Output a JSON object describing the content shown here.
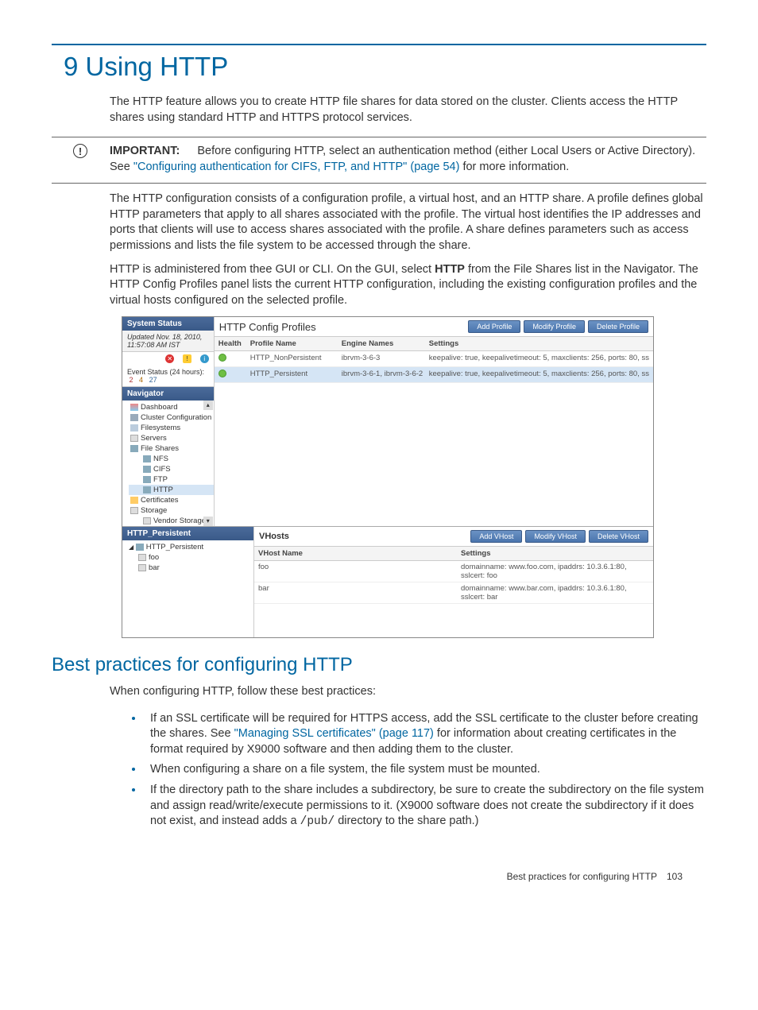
{
  "chapter": {
    "number": "9",
    "title": "Using HTTP"
  },
  "intro": "The HTTP feature allows you to create HTTP file shares for data stored on the cluster. Clients access the HTTP shares using standard HTTP and HTTPS protocol services.",
  "important": {
    "label": "IMPORTANT:",
    "before_link": "Before configuring HTTP, select an authentication method (either Local Users or Active Directory). See ",
    "link": "\"Configuring authentication for CIFS, FTP, and HTTP\" (page 54)",
    "after_link": " for more information."
  },
  "config_para": "The HTTP configuration consists of a configuration profile, a virtual host, and an HTTP share. A profile defines global HTTP parameters that apply to all shares associated with the profile. The virtual host identifies the IP addresses and ports that clients will use to access shares associated with the profile. A share defines parameters such as access permissions and lists the file system to be accessed through the share.",
  "admin_para": {
    "before_bold": "HTTP is administered from thee GUI or CLI. On the GUI, select ",
    "bold": "HTTP",
    "after_bold": " from the File Shares list in the Navigator. The HTTP Config Profiles panel lists the current HTTP configuration, including the existing configuration profiles and the virtual hosts configured on the selected profile."
  },
  "screenshot": {
    "system_status": {
      "title": "System Status",
      "updated": "Updated Nov. 18, 2010, 11:57:08 AM IST",
      "event_label": "Event Status (24 hours):",
      "red": "2",
      "yellow": "4",
      "blue": "27"
    },
    "navigator": {
      "title": "Navigator",
      "items": [
        {
          "label": "Dashboard"
        },
        {
          "label": "Cluster Configuration"
        },
        {
          "label": "Filesystems"
        },
        {
          "label": "Servers"
        },
        {
          "label": "File Shares"
        },
        {
          "label": "NFS",
          "indent": true
        },
        {
          "label": "CIFS",
          "indent": true
        },
        {
          "label": "FTP",
          "indent": true
        },
        {
          "label": "HTTP",
          "indent": true,
          "selected": true
        },
        {
          "label": "Certificates"
        },
        {
          "label": "Storage"
        },
        {
          "label": "Vendor Storage",
          "indent": true
        }
      ]
    },
    "profiles": {
      "title": "HTTP Config Profiles",
      "btn_add": "Add Profile",
      "btn_mod": "Modify Profile",
      "btn_del": "Delete Profile",
      "cols": {
        "health": "Health",
        "profile": "Profile Name",
        "engine": "Engine Names",
        "settings": "Settings"
      },
      "rows": [
        {
          "profile": "HTTP_NonPersistent",
          "engine": "ibrvm-3-6-3",
          "settings": "keepalive: true, keepalivetimeout: 5, maxclients: 256, ports: 80, ss",
          "selected": false
        },
        {
          "profile": "HTTP_Persistent",
          "engine": "ibrvm-3-6-1, ibrvm-3-6-2",
          "settings": "keepalive: true, keepalivetimeout: 5, maxclients: 256, ports: 80, ss",
          "selected": true
        }
      ]
    },
    "tree": {
      "title": "HTTP_Persistent",
      "root": "HTTP_Persistent",
      "items": [
        "foo",
        "bar"
      ]
    },
    "vhosts": {
      "title": "VHosts",
      "btn_add": "Add VHost",
      "btn_mod": "Modify VHost",
      "btn_del": "Delete VHost",
      "cols": {
        "name": "VHost Name",
        "settings": "Settings"
      },
      "rows": [
        {
          "name": "foo",
          "settings": "domainname: www.foo.com, ipaddrs: 10.3.6.1:80, sslcert: foo"
        },
        {
          "name": "bar",
          "settings": "domainname: www.bar.com, ipaddrs: 10.3.6.1:80, sslcert: bar"
        }
      ]
    }
  },
  "section2": {
    "title": "Best practices for configuring HTTP",
    "intro": "When configuring HTTP, follow these best practices:",
    "bullets": {
      "b1": {
        "before_link": "If an SSL certificate will be required for HTTPS access, add the SSL certificate to the cluster before creating the shares. See ",
        "link": "\"Managing SSL certificates\" (page 117)",
        "after_link": " for information about creating certificates in the format required by X9000 software and then adding them to the cluster."
      },
      "b2": "When configuring a share on a file system, the file system must be mounted.",
      "b3": {
        "before_code": "If the directory path to the share includes a subdirectory, be sure to create the subdirectory on the file system and assign read/write/execute permissions to it. (X9000 software does not create the subdirectory if it does not exist, and instead adds a ",
        "code": "/pub/",
        "after_code": " directory to the share path.)"
      }
    }
  },
  "footer": {
    "text": "Best practices for configuring HTTP",
    "page": "103"
  }
}
